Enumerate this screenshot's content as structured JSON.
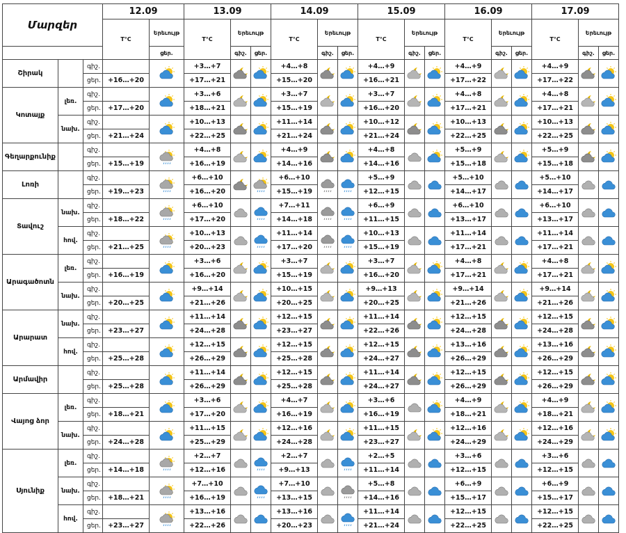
{
  "header": {
    "region_col": "Մարզեր",
    "dates": [
      "12.09",
      "13.09",
      "14.09",
      "15.09",
      "16.09",
      "17.09"
    ],
    "temp_label": "T°C",
    "icon_label": "Երեւույթ",
    "night": "գիշ.",
    "day": "ցեր."
  },
  "regions": [
    {
      "name": "Շիրակ",
      "subs": [
        {
          "label": "",
          "r12": [
            "",
            "+16…+20"
          ],
          "i12": "pc",
          "n": [
            [
              "+3…+7",
              "+17…+21"
            ],
            [
              "+4…+8",
              "+15…+20"
            ],
            [
              "+4…+9",
              "+16…+21"
            ],
            [
              "+4…+9",
              "+17…+22"
            ],
            [
              "+4…+9",
              "+17…+22"
            ]
          ],
          "icons": [
            [
              "ncg",
              "pc"
            ],
            [
              "ncg",
              "pc"
            ],
            [
              "nc",
              "pc"
            ],
            [
              "nc",
              "pc"
            ],
            [
              "ncg",
              "pc"
            ]
          ]
        }
      ]
    },
    {
      "name": "Կոտայք",
      "subs": [
        {
          "label": "լեռ.",
          "r12": [
            "",
            "+17…+20"
          ],
          "i12": "pc",
          "n": [
            [
              "+3…+6",
              "+18…+21"
            ],
            [
              "+3…+7",
              "+15…+19"
            ],
            [
              "+3…+7",
              "+16…+20"
            ],
            [
              "+4…+8",
              "+17…+21"
            ],
            [
              "+4…+8",
              "+17…+21"
            ]
          ],
          "icons": [
            [
              "nc",
              "pc"
            ],
            [
              "nc",
              "pc"
            ],
            [
              "nc",
              "pc"
            ],
            [
              "nc",
              "pc"
            ],
            [
              "nc",
              "pc"
            ]
          ]
        },
        {
          "label": "նախ.",
          "r12": [
            "",
            "+21…+24"
          ],
          "i12": "pc",
          "n": [
            [
              "+10…+13",
              "+22…+25"
            ],
            [
              "+11…+14",
              "+21…+24"
            ],
            [
              "+10…+12",
              "+21…+24"
            ],
            [
              "+10…+13",
              "+22…+25"
            ],
            [
              "+10…+13",
              "+22…+25"
            ]
          ],
          "icons": [
            [
              "ncg",
              "pc"
            ],
            [
              "ncg",
              "pc"
            ],
            [
              "ncg",
              "pc"
            ],
            [
              "ncg",
              "pc"
            ],
            [
              "ncg",
              "pc"
            ]
          ]
        }
      ]
    },
    {
      "name": "Գեղարքունիք",
      "subs": [
        {
          "label": "",
          "r12": [
            "",
            "+15…+19"
          ],
          "i12": "pcr",
          "n": [
            [
              "+4…+8",
              "+16…+19"
            ],
            [
              "+4…+9",
              "+14…+16"
            ],
            [
              "+4…+8",
              "+14…+16"
            ],
            [
              "+5…+9",
              "+15…+18"
            ],
            [
              "+5…+9",
              "+15…+18"
            ]
          ],
          "icons": [
            [
              "nc",
              "pc"
            ],
            [
              "ncg",
              "pc"
            ],
            [
              "cg",
              "pc"
            ],
            [
              "nc",
              "pc"
            ],
            [
              "ncg",
              "pc"
            ]
          ]
        }
      ]
    },
    {
      "name": "Լոռի",
      "subs": [
        {
          "label": "",
          "r12": [
            "",
            "+19…+23"
          ],
          "i12": "pcr",
          "n": [
            [
              "+6…+10",
              "+16…+20"
            ],
            [
              "+6…+10",
              "+15…+19"
            ],
            [
              "+5…+9",
              "+12…+15"
            ],
            [
              "+5…+10",
              "+14…+17"
            ],
            [
              "+5…+10",
              "+14…+17"
            ]
          ],
          "icons": [
            [
              "ncg",
              "pcr"
            ],
            [
              "rg",
              "rb"
            ],
            [
              "cg",
              "cb"
            ],
            [
              "cg",
              "cb"
            ],
            [
              "cg",
              "cb"
            ]
          ]
        }
      ]
    },
    {
      "name": "Տավուշ",
      "subs": [
        {
          "label": "նախ.",
          "r12": [
            "",
            "+18…+22"
          ],
          "i12": "pcr",
          "n": [
            [
              "+6…+10",
              "+17…+20"
            ],
            [
              "+7…+11",
              "+14…+18"
            ],
            [
              "+6…+9",
              "+11…+15"
            ],
            [
              "+6…+10",
              "+13…+17"
            ],
            [
              "+6…+10",
              "+13…+17"
            ]
          ],
          "icons": [
            [
              "cg",
              "rb"
            ],
            [
              "rg",
              "rb"
            ],
            [
              "cg",
              "cb"
            ],
            [
              "cg",
              "cb"
            ],
            [
              "cg",
              "cb"
            ]
          ]
        },
        {
          "label": "հով.",
          "r12": [
            "",
            "+21…+25"
          ],
          "i12": "pcr",
          "n": [
            [
              "+10…+13",
              "+20…+23"
            ],
            [
              "+11…+14",
              "+17…+20"
            ],
            [
              "+10…+13",
              "+15…+19"
            ],
            [
              "+11…+14",
              "+17…+21"
            ],
            [
              "+11…+14",
              "+17…+21"
            ]
          ],
          "icons": [
            [
              "cg",
              "rb"
            ],
            [
              "rg",
              "rb"
            ],
            [
              "cg",
              "cb"
            ],
            [
              "cg",
              "cb"
            ],
            [
              "cg",
              "cb"
            ]
          ]
        }
      ]
    },
    {
      "name": "Արագածոտն",
      "subs": [
        {
          "label": "լեռ.",
          "r12": [
            "",
            "+16…+19"
          ],
          "i12": "pc",
          "n": [
            [
              "+3…+6",
              "+16…+20"
            ],
            [
              "+3…+7",
              "+15…+19"
            ],
            [
              "+3…+7",
              "+16…+20"
            ],
            [
              "+4…+8",
              "+17…+21"
            ],
            [
              "+4…+8",
              "+17…+21"
            ]
          ],
          "icons": [
            [
              "nc",
              "pc"
            ],
            [
              "nc",
              "pc"
            ],
            [
              "nc",
              "pc"
            ],
            [
              "nc",
              "pc"
            ],
            [
              "nc",
              "pc"
            ]
          ]
        },
        {
          "label": "նախ.",
          "r12": [
            "",
            "+20…+25"
          ],
          "i12": "pc",
          "n": [
            [
              "+9…+14",
              "+21…+26"
            ],
            [
              "+10…+15",
              "+20…+25"
            ],
            [
              "+9…+13",
              "+20…+25"
            ],
            [
              "+9…+14",
              "+21…+26"
            ],
            [
              "+9…+14",
              "+21…+26"
            ]
          ],
          "icons": [
            [
              "nc",
              "pc"
            ],
            [
              "nc",
              "pc"
            ],
            [
              "nc",
              "pc"
            ],
            [
              "nc",
              "pc"
            ],
            [
              "nc",
              "pc"
            ]
          ]
        }
      ]
    },
    {
      "name": "Արարատ",
      "subs": [
        {
          "label": "նախ.",
          "r12": [
            "",
            "+23…+27"
          ],
          "i12": "pc",
          "n": [
            [
              "+11…+14",
              "+24…+28"
            ],
            [
              "+12…+15",
              "+23…+27"
            ],
            [
              "+11…+14",
              "+22…+26"
            ],
            [
              "+12…+15",
              "+24…+28"
            ],
            [
              "+12…+15",
              "+24…+28"
            ]
          ],
          "icons": [
            [
              "ncg",
              "pc"
            ],
            [
              "ncg",
              "pc"
            ],
            [
              "ncg",
              "pc"
            ],
            [
              "ncg",
              "pc"
            ],
            [
              "ncg",
              "pc"
            ]
          ]
        },
        {
          "label": "հով.",
          "r12": [
            "",
            "+25…+28"
          ],
          "i12": "pc",
          "n": [
            [
              "+12…+15",
              "+26…+29"
            ],
            [
              "+12…+15",
              "+25…+28"
            ],
            [
              "+12…+15",
              "+24…+27"
            ],
            [
              "+13…+16",
              "+26…+29"
            ],
            [
              "+13…+16",
              "+26…+29"
            ]
          ],
          "icons": [
            [
              "ncg",
              "pc"
            ],
            [
              "ncg",
              "pc"
            ],
            [
              "ncg",
              "pc"
            ],
            [
              "ncg",
              "pc"
            ],
            [
              "ncg",
              "pc"
            ]
          ]
        }
      ]
    },
    {
      "name": "Արմավիր",
      "subs": [
        {
          "label": "",
          "r12": [
            "",
            "+25…+28"
          ],
          "i12": "pc",
          "n": [
            [
              "+11…+14",
              "+26…+29"
            ],
            [
              "+12…+15",
              "+25…+28"
            ],
            [
              "+11…+14",
              "+24…+27"
            ],
            [
              "+12…+15",
              "+26…+29"
            ],
            [
              "+12…+15",
              "+26…+29"
            ]
          ],
          "icons": [
            [
              "ncg",
              "pc"
            ],
            [
              "ncg",
              "pc"
            ],
            [
              "ncg",
              "pc"
            ],
            [
              "ncg",
              "pc"
            ],
            [
              "ncg",
              "pc"
            ]
          ]
        }
      ]
    },
    {
      "name": "Վայոց ձոր",
      "subs": [
        {
          "label": "լեռ.",
          "r12": [
            "",
            "+18…+21"
          ],
          "i12": "pc",
          "n": [
            [
              "+3…+6",
              "+17…+20"
            ],
            [
              "+4…+7",
              "+16…+19"
            ],
            [
              "+3…+6",
              "+16…+19"
            ],
            [
              "+4…+9",
              "+18…+21"
            ],
            [
              "+4…+9",
              "+18…+21"
            ]
          ],
          "icons": [
            [
              "nc",
              "pc"
            ],
            [
              "nc",
              "pc"
            ],
            [
              "cg",
              "pc"
            ],
            [
              "nc",
              "pc"
            ],
            [
              "nc",
              "pc"
            ]
          ]
        },
        {
          "label": "նախ.",
          "r12": [
            "",
            "+24…+28"
          ],
          "i12": "pc",
          "n": [
            [
              "+11…+15",
              "+25…+29"
            ],
            [
              "+12…+16",
              "+24…+28"
            ],
            [
              "+11…+15",
              "+23…+27"
            ],
            [
              "+12…+16",
              "+24…+29"
            ],
            [
              "+12…+16",
              "+24…+29"
            ]
          ],
          "icons": [
            [
              "nc",
              "pc"
            ],
            [
              "nc",
              "pc"
            ],
            [
              "nc",
              "pc"
            ],
            [
              "nc",
              "pc"
            ],
            [
              "nc",
              "pc"
            ]
          ]
        }
      ]
    },
    {
      "name": "Սյունիք",
      "subs": [
        {
          "label": "լեռ.",
          "r12": [
            "",
            "+14…+18"
          ],
          "i12": "pcr",
          "n": [
            [
              "+2…+7",
              "+12…+16"
            ],
            [
              "+2…+7",
              "+9…+13"
            ],
            [
              "+2…+5",
              "+11…+14"
            ],
            [
              "+3…+6",
              "+12…+15"
            ],
            [
              "+3…+6",
              "+12…+15"
            ]
          ],
          "icons": [
            [
              "cg",
              "rb"
            ],
            [
              "cg",
              "rb"
            ],
            [
              "cg",
              "cb"
            ],
            [
              "cg",
              "cb"
            ],
            [
              "cg",
              "cb"
            ]
          ]
        },
        {
          "label": "նախ.",
          "r12": [
            "",
            "+18…+21"
          ],
          "i12": "pcr",
          "n": [
            [
              "+7…+10",
              "+16…+19"
            ],
            [
              "+7…+10",
              "+13…+15"
            ],
            [
              "+5…+8",
              "+14…+16"
            ],
            [
              "+6…+9",
              "+15…+17"
            ],
            [
              "+6…+9",
              "+15…+17"
            ]
          ],
          "icons": [
            [
              "cg",
              "rb"
            ],
            [
              "cg",
              "rg"
            ],
            [
              "cg",
              "cb"
            ],
            [
              "cg",
              "cb"
            ],
            [
              "cg",
              "cb"
            ]
          ]
        },
        {
          "label": "հով.",
          "r12": [
            "",
            "+23…+27"
          ],
          "i12": "pcr",
          "n": [
            [
              "+13…+16",
              "+22…+26"
            ],
            [
              "+13…+16",
              "+20…+23"
            ],
            [
              "+11…+14",
              "+21…+24"
            ],
            [
              "+12…+15",
              "+22…+25"
            ],
            [
              "+12…+15",
              "+22…+25"
            ]
          ],
          "icons": [
            [
              "cg",
              "cb"
            ],
            [
              "cg",
              "rb"
            ],
            [
              "cg",
              "cb"
            ],
            [
              "cg",
              "cb"
            ],
            [
              "cg",
              "cb"
            ]
          ]
        }
      ]
    }
  ],
  "icon_types": {
    "pc": "partly-cloudy-sun-icon",
    "pcr": "partly-cloudy-rain-icon",
    "nc": "night-cloud-moon-icon",
    "ncg": "night-grey-cloud-moon-icon",
    "cg": "grey-cloud-icon",
    "cb": "blue-cloud-icon",
    "rg": "grey-rain-cloud-icon",
    "rb": "blue-rain-cloud-icon"
  },
  "colors": {
    "sun": "#f5c518",
    "blue_cloud": "#3a8fd6",
    "grey_cloud": "#9a9a9a",
    "moon": "#e3b400"
  }
}
